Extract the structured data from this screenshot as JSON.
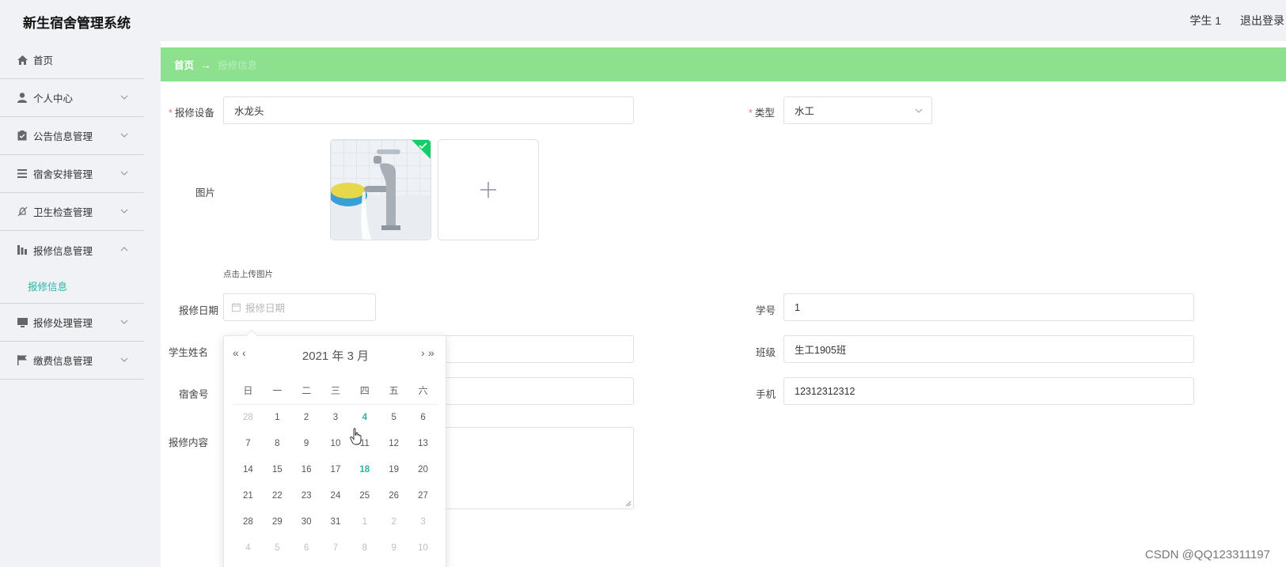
{
  "app": {
    "title": "新生宿舍管理系统",
    "user": "学生 1",
    "logout": "退出登录"
  },
  "sidebar": {
    "items": [
      {
        "label": "首页",
        "icon": "home-icon"
      },
      {
        "label": "个人中心",
        "icon": "user-icon"
      },
      {
        "label": "公告信息管理",
        "icon": "clipboard-icon"
      },
      {
        "label": "宿舍安排管理",
        "icon": "list-icon"
      },
      {
        "label": "卫生检查管理",
        "icon": "bell-off-icon"
      },
      {
        "label": "报修信息管理",
        "icon": "chart-icon"
      },
      {
        "label": "报修处理管理",
        "icon": "monitor-icon"
      },
      {
        "label": "缴费信息管理",
        "icon": "flag-icon"
      }
    ],
    "sub_item": "报修信息"
  },
  "breadcrumb": {
    "home": "首页",
    "arrow": "→",
    "current": "报修信息"
  },
  "form": {
    "device_label": "报修设备",
    "device_value": "水龙头",
    "type_label": "类型",
    "type_value": "水工",
    "image_label": "图片",
    "upload_tip": "点击上传图片",
    "date_label": "报修日期",
    "date_placeholder": "报修日期",
    "student_no_label": "学号",
    "student_no_value": "1",
    "name_label": "学生姓名",
    "class_label": "班级",
    "class_value": "生工1905班",
    "dorm_label": "宿舍号",
    "phone_label": "手机",
    "phone_value": "12312312312",
    "content_label": "报修内容",
    "required_mark": "*"
  },
  "datepicker": {
    "header": "2021 年  3 月",
    "prev_year": "«",
    "prev_month": "‹",
    "next_month": "›",
    "next_year": "»",
    "weekdays": [
      "日",
      "一",
      "二",
      "三",
      "四",
      "五",
      "六"
    ],
    "weeks": [
      [
        "28",
        "1",
        "2",
        "3",
        "4",
        "5",
        "6"
      ],
      [
        "7",
        "8",
        "9",
        "10",
        "11",
        "12",
        "13"
      ],
      [
        "14",
        "15",
        "16",
        "17",
        "18",
        "19",
        "20"
      ],
      [
        "21",
        "22",
        "23",
        "24",
        "25",
        "26",
        "27"
      ],
      [
        "28",
        "29",
        "30",
        "31",
        "1",
        "2",
        "3"
      ],
      [
        "4",
        "5",
        "6",
        "7",
        "8",
        "9",
        "10"
      ]
    ]
  },
  "watermark": "CSDN @QQ123311197",
  "colors": {
    "accent": "#2bb3a5",
    "breadcrumb_bg": "#8ce08e",
    "required": "#f56c6c"
  }
}
